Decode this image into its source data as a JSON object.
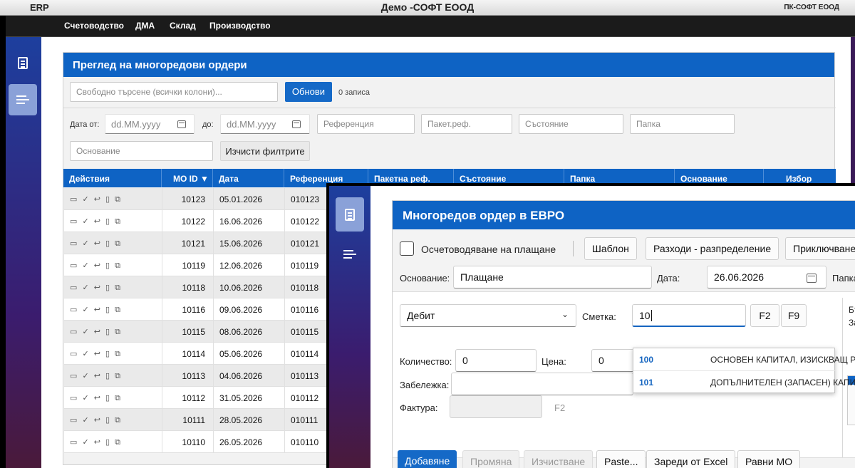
{
  "app_title": "ERP",
  "window_title": "Демо -СОФТ ЕООД",
  "window_right": "ПК-СОФТ ЕООД",
  "menu": [
    "Счетоводство",
    "ДМА",
    "Склад",
    "Производство"
  ],
  "list": {
    "title": "Преглед на многоредови ордери",
    "search_placeholder": "Свободно търсене (всички колони)...",
    "refresh_label": "Обнови",
    "records": "0 записа",
    "date_from_label": "Дата от:",
    "date_to_label": "до:",
    "date_placeholder": "dd.MM.yyyy",
    "filters": {
      "reference": "Референция",
      "package_ref": "Пакет.реф.",
      "status": "Състояние",
      "folder": "Папка",
      "basis": "Основание"
    },
    "clear_filters_label": "Изчисти филтрите",
    "columns": [
      "Действия",
      "МО ID ▼",
      "Дата",
      "Референция",
      "Пакетна реф.",
      "Състояние",
      "Папка",
      "Основание",
      "Избор"
    ],
    "action_glyphs": "▭ ✓ ↩ ▯ ⧉",
    "rows": [
      {
        "id": "10123",
        "date": "05.01.2026",
        "ref": "010123"
      },
      {
        "id": "10122",
        "date": "16.06.2026",
        "ref": "010122"
      },
      {
        "id": "10121",
        "date": "15.06.2026",
        "ref": "010121"
      },
      {
        "id": "10119",
        "date": "12.06.2026",
        "ref": "010119"
      },
      {
        "id": "10118",
        "date": "10.06.2026",
        "ref": "010118"
      },
      {
        "id": "10116",
        "date": "09.06.2026",
        "ref": "010116"
      },
      {
        "id": "10115",
        "date": "08.06.2026",
        "ref": "010115"
      },
      {
        "id": "10114",
        "date": "05.06.2026",
        "ref": "010114"
      },
      {
        "id": "10113",
        "date": "04.06.2026",
        "ref": "010113"
      },
      {
        "id": "10112",
        "date": "31.05.2026",
        "ref": "010112"
      },
      {
        "id": "10111",
        "date": "28.05.2026",
        "ref": "010111"
      },
      {
        "id": "10110",
        "date": "26.05.2026",
        "ref": "010110"
      }
    ]
  },
  "order": {
    "title": "Многоредов ордер в ЕВРО",
    "payment_checkbox_label": "Осчетоводяване на плащане",
    "template_label": "Шаблон",
    "expenses_label": "Разходи - разпределение",
    "close_label": "Приключване",
    "basis_label": "Основание:",
    "basis_value": "Плащане",
    "date_label": "Дата:",
    "date_value": "26.06.2026",
    "folder_label": "Папка",
    "side_type": "Дебит",
    "account_label": "Сметка:",
    "account_value": "10",
    "f2_label": "F2",
    "f9_label": "F9",
    "right_edge_text_1": "Бъ",
    "right_edge_text_2": "За",
    "qty_label": "Количество:",
    "qty_value": "0",
    "price_label": "Цена:",
    "price_value": "0",
    "note_label": "Забележка:",
    "invoice_label": "Фактура:",
    "invoice_f2": "F2",
    "suggestions": [
      {
        "code": "100",
        "name": "ОСНОВЕН КАПИТАЛ, ИЗИСКВАЩ Р"
      },
      {
        "code": "101",
        "name": "ДОПЪЛНИТЕЛЕН (ЗАПАСЕН) КАПИ"
      }
    ],
    "footer": {
      "add": "Добавяне",
      "change": "Промяна",
      "clear": "Изчистване",
      "paste": "Paste...",
      "load_excel": "Зареди от Excel",
      "equal": "Равни МО"
    }
  }
}
